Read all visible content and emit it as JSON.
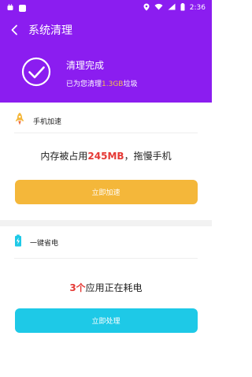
{
  "status_bar": {
    "time": "2:36"
  },
  "header": {
    "back_icon": "chevron-left-icon",
    "title": "系统清理"
  },
  "hero": {
    "title": "清理完成",
    "sub_prefix": "已为您清理",
    "amount": "1.3GB",
    "sub_suffix": "垃圾"
  },
  "boost_card": {
    "label": "手机加速",
    "msg_prefix": "内存被占用",
    "msg_value": "245MB",
    "msg_suffix": "，拖慢手机",
    "button": "立即加速"
  },
  "power_card": {
    "label": "一键省电",
    "msg_value": "3个",
    "msg_suffix": "应用正在耗电",
    "button": "立即处理"
  },
  "colors": {
    "primary": "#8b1df0",
    "orange": "#f4b73a",
    "cyan": "#1ec9e7",
    "accent_red": "#e53935",
    "amount_gold": "#f2c24a"
  }
}
